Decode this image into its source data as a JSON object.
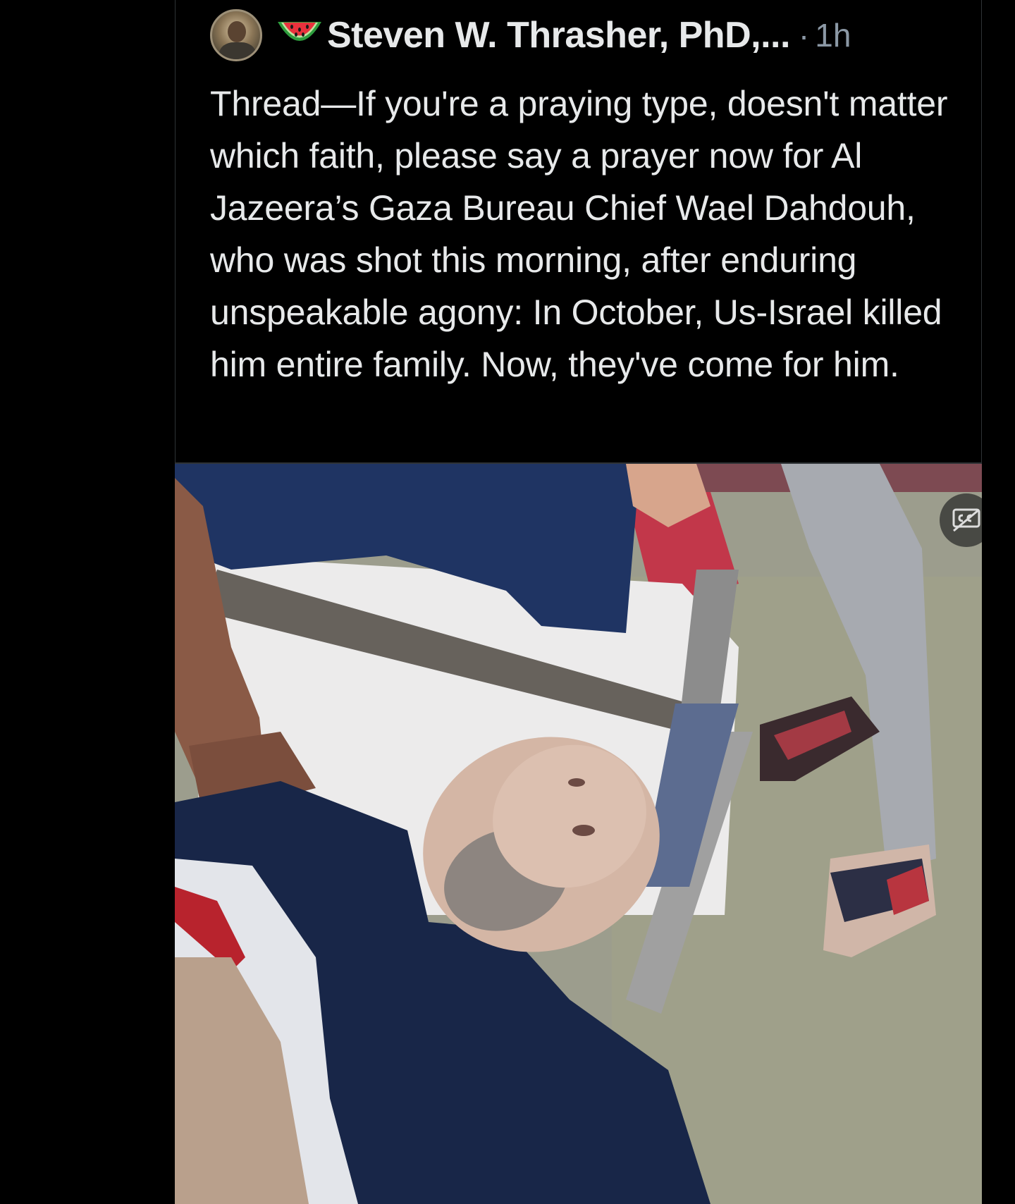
{
  "post": {
    "author_name": "Steven W. Thrasher, PhD,...",
    "separator": "·",
    "timestamp": "1h",
    "text": "Thread—If you're a praying type, doesn't matter which faith, please say a prayer now for Al Jazeera’s Gaza Bureau Chief Wael Dahdouh, who was shot this morning, after enduring unspeakable agony: In October, Us-Israel killed him entire family. Now, they've come for him.",
    "name_emoji_icon": "watermelon-icon",
    "avatar_icon": "profile-photo"
  },
  "media": {
    "type": "video",
    "captions_icon": "closed-captions-icon"
  },
  "colors": {
    "background": "#000000",
    "text_primary": "#e7e9ea",
    "text_secondary": "#8b98a5",
    "border": "#2f3336"
  }
}
